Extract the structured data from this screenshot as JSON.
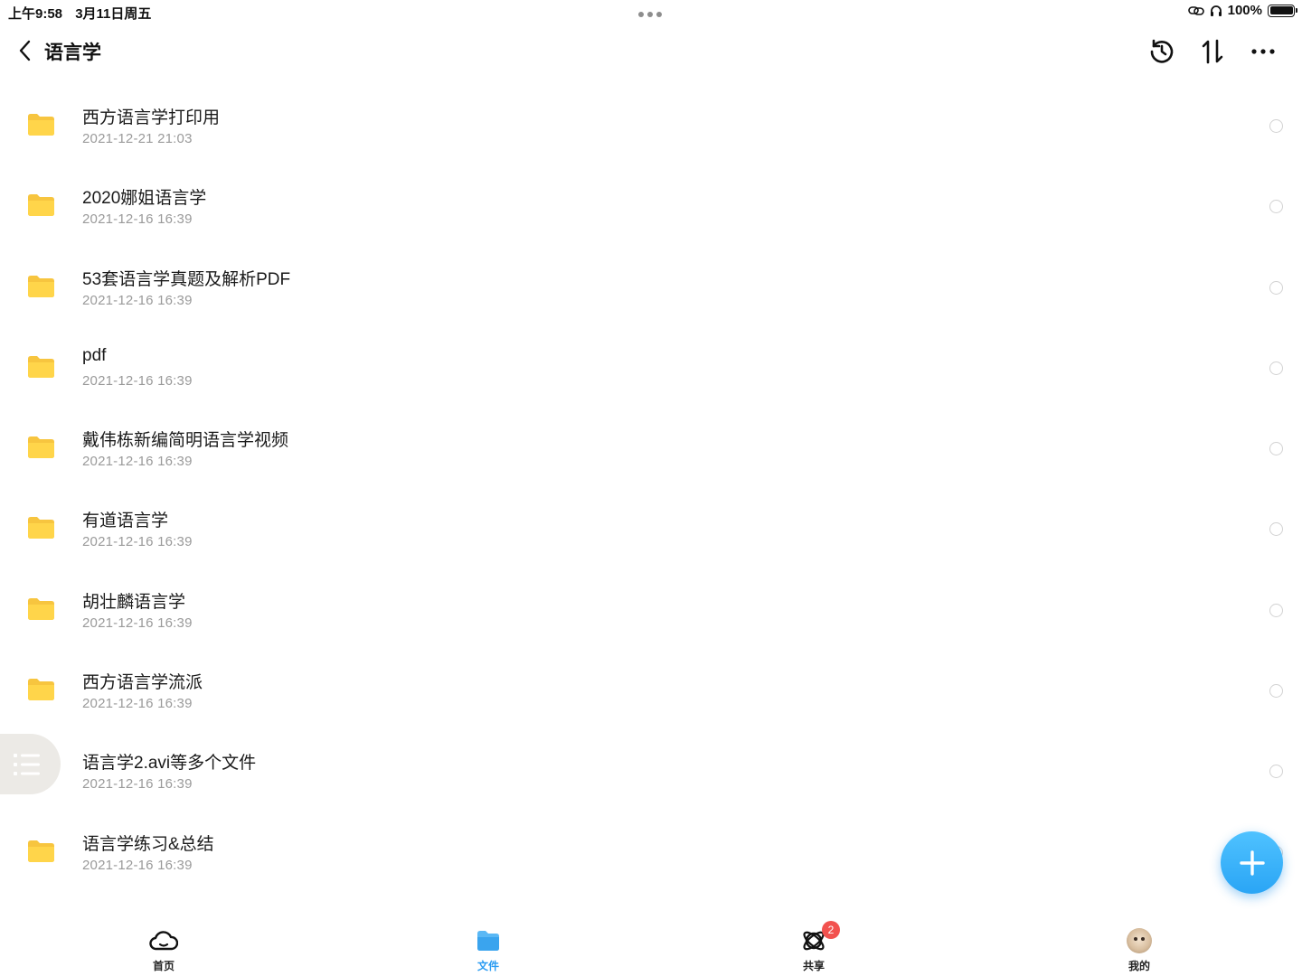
{
  "status_bar": {
    "time": "上午9:58",
    "date": "3月11日周五",
    "battery_text": "100%",
    "battery_level": 1.0
  },
  "nav": {
    "title": "语言学"
  },
  "files": [
    {
      "name": "西方语言学打印用",
      "date": "2021-12-21 21:03"
    },
    {
      "name": "2020娜姐语言学",
      "date": "2021-12-16 16:39"
    },
    {
      "name": "53套语言学真题及解析PDF",
      "date": "2021-12-16 16:39"
    },
    {
      "name": "pdf",
      "date": "2021-12-16 16:39"
    },
    {
      "name": "戴伟栋新编简明语言学视频",
      "date": "2021-12-16 16:39"
    },
    {
      "name": "有道语言学",
      "date": "2021-12-16 16:39"
    },
    {
      "name": "胡壮麟语言学",
      "date": "2021-12-16 16:39"
    },
    {
      "name": "西方语言学流派",
      "date": "2021-12-16 16:39"
    },
    {
      "name": "语言学2.avi等多个文件",
      "date": "2021-12-16 16:39"
    },
    {
      "name": "语言学练习&总结",
      "date": "2021-12-16 16:39"
    }
  ],
  "tabs": [
    {
      "label": "首页",
      "icon": "cloud-icon"
    },
    {
      "label": "文件",
      "icon": "folder-icon",
      "active": true
    },
    {
      "label": "共享",
      "icon": "share-planet-icon",
      "badge": "2"
    },
    {
      "label": "我的",
      "icon": "avatar"
    }
  ],
  "colors": {
    "accent": "#2b9cf2",
    "folder": "#ffd54a",
    "badge": "#f2524f"
  }
}
